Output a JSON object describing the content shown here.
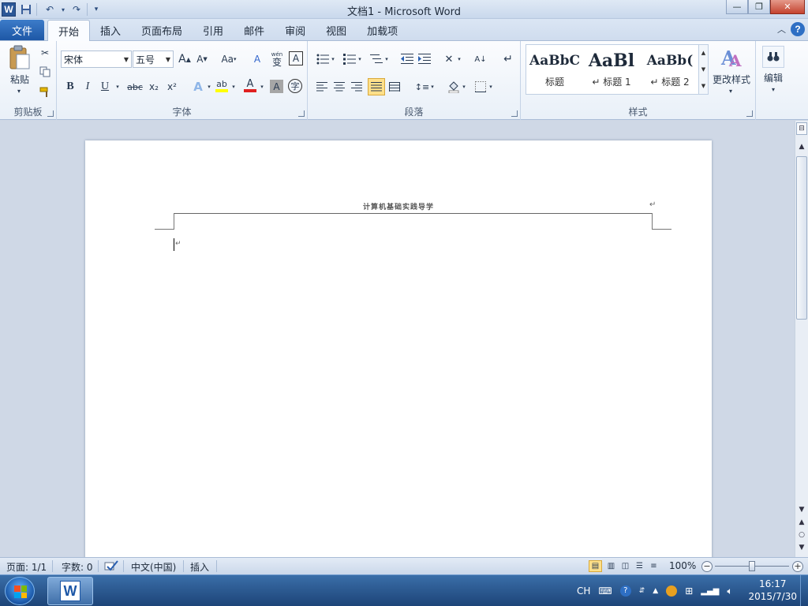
{
  "window": {
    "title": "文档1  -  Microsoft Word",
    "app_icon_letter": "W",
    "minimize_glyph": "—",
    "maximize_glyph": "❐",
    "close_glyph": "✕"
  },
  "tabs": {
    "file": "文件",
    "items": [
      "开始",
      "插入",
      "页面布局",
      "引用",
      "邮件",
      "审阅",
      "视图",
      "加载项"
    ],
    "active_index": 0,
    "help_glyph": "?"
  },
  "ribbon": {
    "clipboard": {
      "group_label": "剪贴板",
      "paste_label": "粘贴"
    },
    "font": {
      "group_label": "字体",
      "font_name": "宋体",
      "font_size": "五号",
      "bold": "B",
      "italic": "I",
      "underline": "U",
      "strike": "abc",
      "subscript": "x₂",
      "superscript": "x²",
      "grow": "A",
      "shrink": "A",
      "case": "Aa",
      "clear": "A",
      "highlight": "ab",
      "font_color": "A",
      "char_shade": "A",
      "enclose": "字",
      "phonetic": "wén",
      "phonetic_char": "变",
      "border_char": "A"
    },
    "paragraph": {
      "group_label": "段落"
    },
    "styles": {
      "group_label": "样式",
      "items": [
        {
          "preview": "AaBbC",
          "name": "标题"
        },
        {
          "preview": "AaBl",
          "name": "↵ 标题 1"
        },
        {
          "preview": "AaBb(",
          "name": "↵ 标题 2"
        }
      ],
      "change_label": "更改样式"
    },
    "editing": {
      "label": "编辑"
    }
  },
  "document": {
    "header_text": "计算机基础实践导学",
    "paragraph_mark": "↵"
  },
  "statusbar": {
    "page": "页面: 1/1",
    "words": "字数: 0",
    "language": "中文(中国)",
    "mode": "插入",
    "zoom": "100%",
    "zoom_level": 0.5
  },
  "taskbar": {
    "word_letter": "W",
    "tray_lang": "CH",
    "time": "16:17",
    "date": "2015/7/30"
  },
  "colors": {
    "file_tab": "#1d57a6",
    "accent": "#2b5797",
    "highlight_yellow": "#ffe08a",
    "font_red": "#e02020"
  }
}
